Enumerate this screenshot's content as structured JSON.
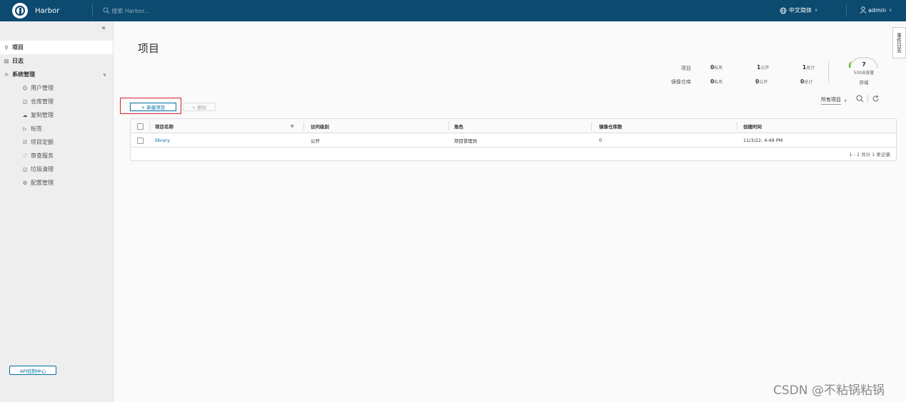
{
  "header": {
    "brand": "Harbor",
    "search_placeholder": "搜索 Harbor...",
    "language": "中文简体",
    "user": "admin"
  },
  "sidebar": {
    "items": [
      {
        "label": "项目",
        "icon": "projects-icon",
        "active": true
      },
      {
        "label": "日志",
        "icon": "logs-icon"
      },
      {
        "label": "系统管理",
        "icon": "admin-icon"
      },
      {
        "label": "用户管理",
        "icon": "users-icon"
      },
      {
        "label": "仓库管理",
        "icon": "registry-icon"
      },
      {
        "label": "复制管理",
        "icon": "replication-icon"
      },
      {
        "label": "标签",
        "icon": "tag-icon"
      },
      {
        "label": "项目定额",
        "icon": "quota-icon"
      },
      {
        "label": "审查服务",
        "icon": "shield-icon"
      },
      {
        "label": "垃圾清理",
        "icon": "trash-icon"
      },
      {
        "label": "配置管理",
        "icon": "gear-icon"
      }
    ],
    "api_button": "API控制中心"
  },
  "main": {
    "title": "项目",
    "stats": {
      "row1_label": "项目",
      "row2_label": "镜像仓库",
      "private_label": "私有",
      "public_label": "公开",
      "total_label": "总计",
      "projects": {
        "private": "0",
        "public": "1",
        "total": "1"
      },
      "repos": {
        "private": "0",
        "public": "0",
        "total": "0"
      }
    },
    "storage": {
      "value": "7",
      "capacity": "50GB容量",
      "label": "存储"
    },
    "toolbar": {
      "new_project": "+ 新建项目",
      "delete": "× 删除"
    },
    "filter": {
      "selected": "所有项目"
    },
    "table": {
      "columns": [
        "项目名称",
        "访问级别",
        "角色",
        "镜像仓库数",
        "创建时间"
      ],
      "rows": [
        {
          "name": "library",
          "access": "公开",
          "role": "项目管理员",
          "repo_count": "0",
          "created": "11/3/22, 4:49 PM"
        }
      ],
      "footer": "1 - 1 共计 1 条记录"
    },
    "side_tab": "事件日志"
  },
  "watermark": "CSDN @不粘锅粘锅",
  "colors": {
    "header_bg": "#0c4a70",
    "link": "#0072a3",
    "highlight": "#d9232e",
    "gauge": "#5eb715"
  }
}
